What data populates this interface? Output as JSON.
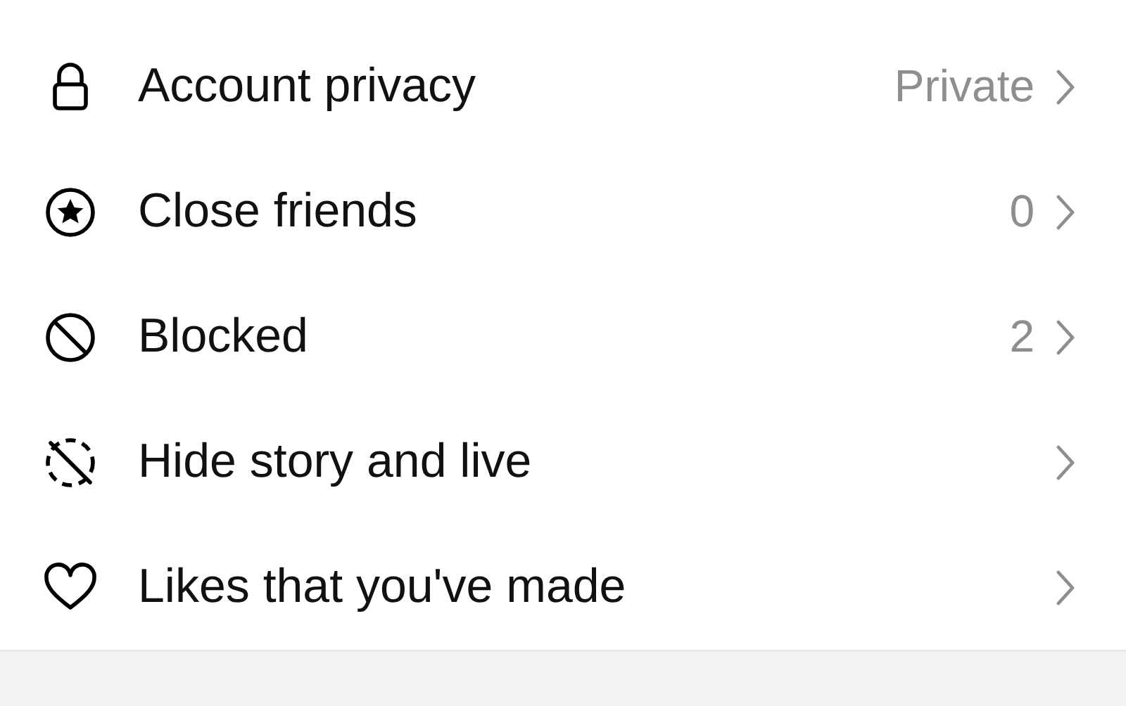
{
  "settings": [
    {
      "label": "Account privacy",
      "value": "Private"
    },
    {
      "label": "Close friends",
      "value": "0"
    },
    {
      "label": "Blocked",
      "value": "2"
    },
    {
      "label": "Hide story and live"
    },
    {
      "label": "Likes that you've made"
    }
  ]
}
